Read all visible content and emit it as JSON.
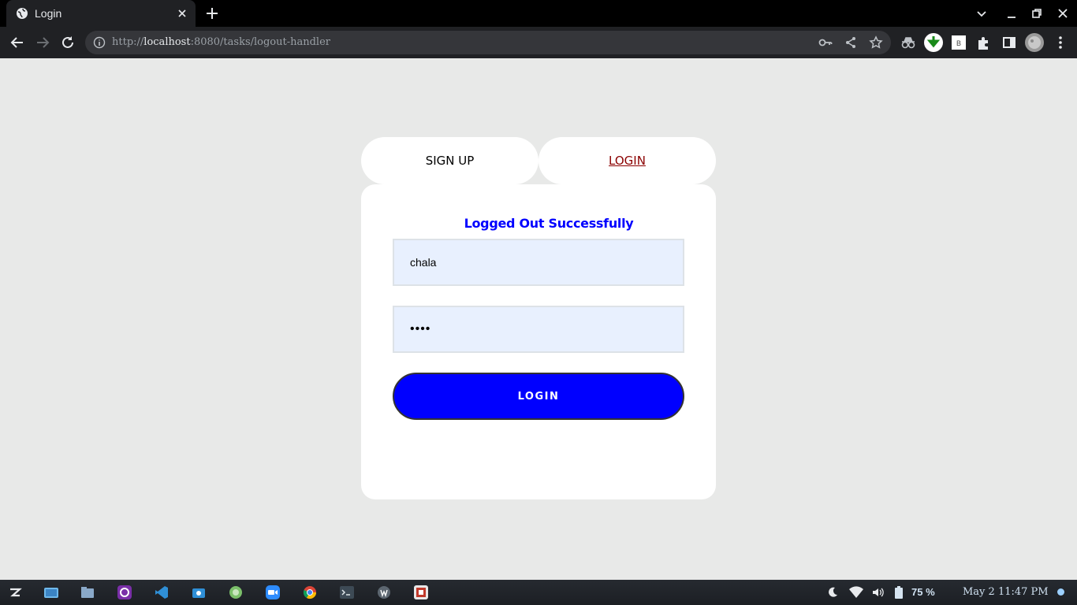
{
  "browser": {
    "tab_title": "Login",
    "url_scheme": "http://",
    "url_host": "localhost",
    "url_path": ":8080/tasks/logout-handler"
  },
  "auth": {
    "tabs": [
      {
        "label": "SIGN UP"
      },
      {
        "label": "LOGIN"
      }
    ],
    "message": "Logged Out Successfully",
    "username_value": "chala",
    "password_value": "••••",
    "submit_label": "LOGIN"
  },
  "taskbar": {
    "apps": [
      "zorin-menu-icon",
      "workspaces-icon",
      "files-icon",
      "github-desktop-icon",
      "vscode-icon",
      "screenshot-icon",
      "android-studio-icon",
      "zoom-icon",
      "chrome-icon",
      "terminal-icon",
      "web-icon",
      "libreoffice-icon"
    ],
    "battery": "75 %",
    "clock": "May 2  11:47 PM"
  },
  "colors": {
    "accent": "#0000ff",
    "active_tab": "#8b0000",
    "page_bg": "#e8e9e8"
  }
}
